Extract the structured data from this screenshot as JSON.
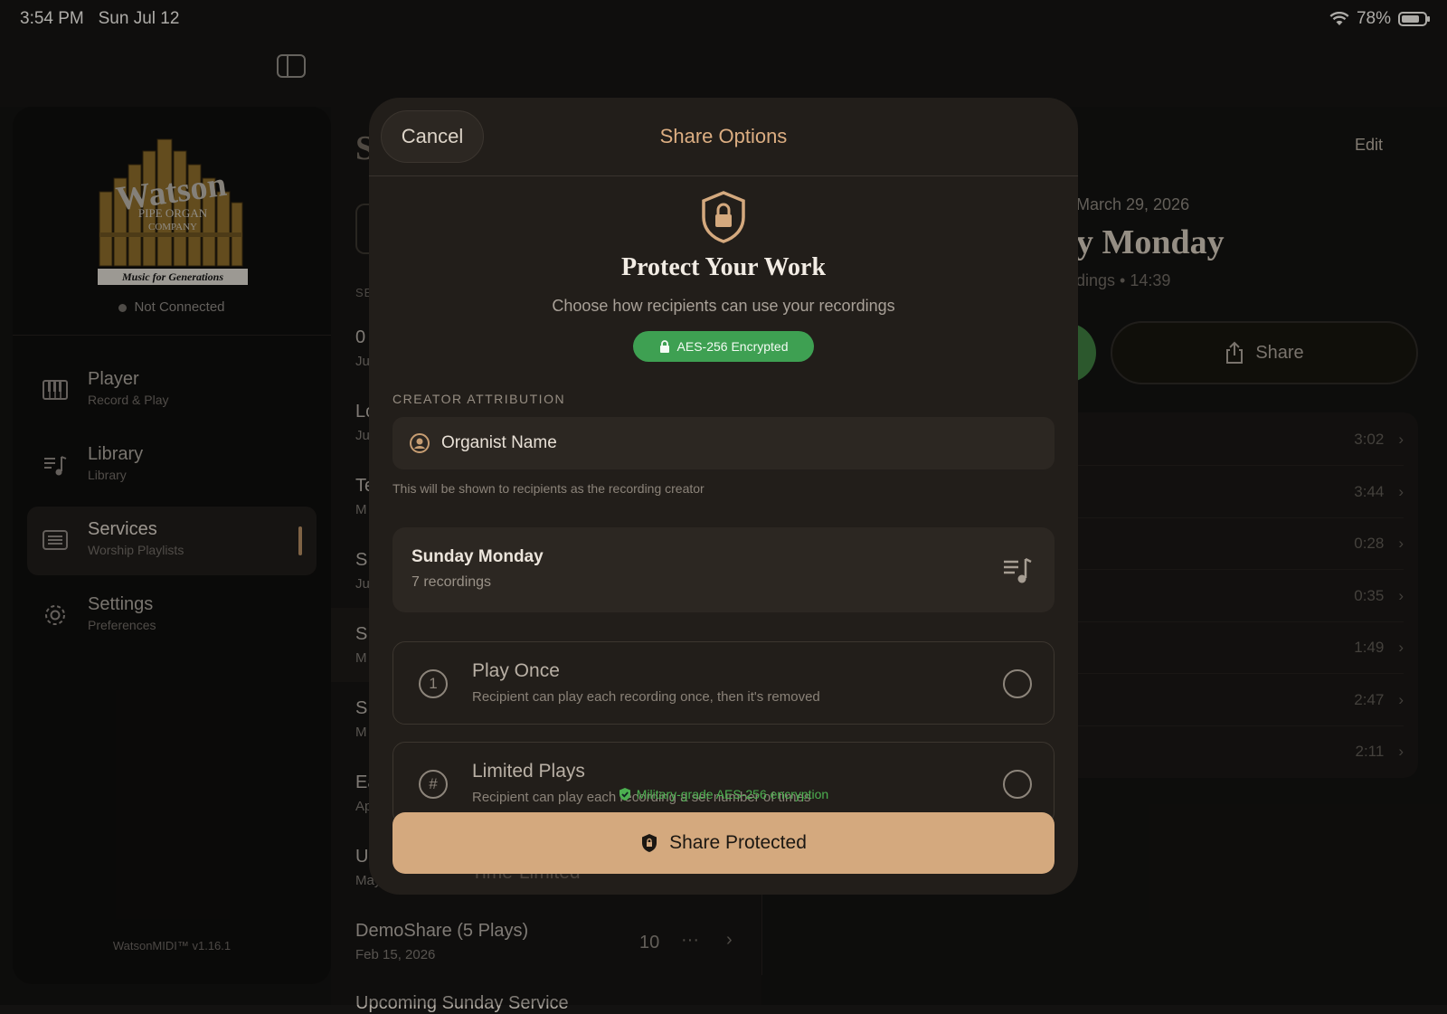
{
  "status_bar": {
    "time": "3:54 PM",
    "date": "Sun Jul 12",
    "battery": "78%"
  },
  "sidebar": {
    "connection": "Not Connected",
    "logo_text": [
      "Watson",
      "PIPE ORGAN",
      "COMPANY",
      "Music for Generations"
    ],
    "items": [
      {
        "title": "Player",
        "subtitle": "Record & Play",
        "icon": "piano-keys-icon"
      },
      {
        "title": "Library",
        "subtitle": "Library",
        "icon": "music-list-icon"
      },
      {
        "title": "Services",
        "subtitle": "Worship Playlists",
        "icon": "list-rect-icon"
      },
      {
        "title": "Settings",
        "subtitle": "Preferences",
        "icon": "gear-icon"
      }
    ],
    "version": "WatsonMIDI™ v1.16.1"
  },
  "middle_list": {
    "header_fragment": "S",
    "section_fragment": "SE",
    "items": [
      {
        "title": "0",
        "sub": "Ju"
      },
      {
        "title": "Lo",
        "sub": "Ju"
      },
      {
        "title": "Te",
        "sub": "M"
      },
      {
        "title": "S",
        "sub": "Ju"
      },
      {
        "title": "S",
        "sub": "M"
      },
      {
        "title": "S",
        "sub": "M"
      },
      {
        "title": "Ea",
        "sub": "Ap"
      },
      {
        "title": "U",
        "sub": "May"
      }
    ],
    "demo": {
      "title": "DemoShare (5 Plays)",
      "date": "Feb 15, 2026",
      "count": "10"
    },
    "upcoming": "Upcoming Sunday Service"
  },
  "detail": {
    "edit": "Edit",
    "date": "March 29, 2026",
    "title": "y Monday",
    "subtitle": "dings • 14:39",
    "share": "Share",
    "durations": [
      "3:02",
      "3:44",
      "0:28",
      "0:35",
      "1:49",
      "2:47",
      "2:11"
    ]
  },
  "modal": {
    "cancel": "Cancel",
    "title": "Share Options",
    "heading": "Protect Your Work",
    "subheading": "Choose how recipients can use your recordings",
    "badge": "AES-256 Encrypted",
    "section_label": "CREATOR ATTRIBUTION",
    "name_value": "Organist Name",
    "hint": "This will be shown to recipients as the recording creator",
    "playlist": {
      "title": "Sunday Monday",
      "count": "7 recordings"
    },
    "options": [
      {
        "title": "Play Once",
        "subtitle": "Recipient can play each recording once, then it's removed",
        "icon": "1"
      },
      {
        "title": "Limited Plays",
        "subtitle": "Recipient can play each recording a set number of times",
        "icon": "#"
      },
      {
        "title": "Time-Limited",
        "subtitle": "",
        "icon": ""
      }
    ],
    "security_note": "Military-grade AES-256 encryption",
    "share_button": "Share Protected"
  },
  "colors": {
    "accent": "#d4a97e",
    "green": "#3ea052",
    "background": "#131211",
    "modal": "#221e1a"
  }
}
